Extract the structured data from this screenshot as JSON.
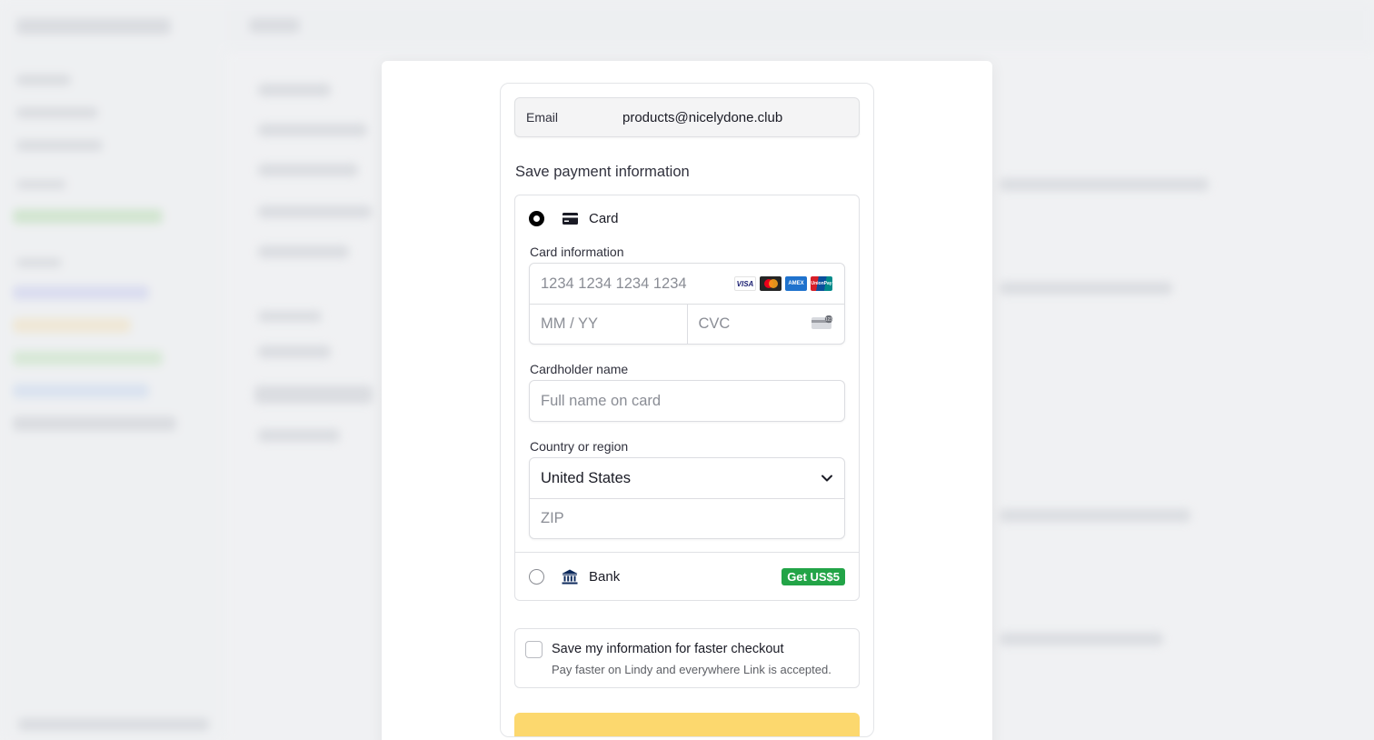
{
  "checkout": {
    "email_label": "Email",
    "email_value": "products@nicelydone.club",
    "section_title": "Save payment information",
    "card": {
      "label": "Card",
      "card_info_label": "Card information",
      "card_number_placeholder": "1234 1234 1234 1234",
      "brands": [
        "VISA",
        "",
        "AMEX",
        "UnionPay"
      ],
      "expiry_placeholder": "MM / YY",
      "cvc_placeholder": "CVC",
      "cardholder_label": "Cardholder name",
      "cardholder_placeholder": "Full name on card",
      "country_label": "Country or region",
      "country_value": "United States",
      "zip_placeholder": "ZIP"
    },
    "bank": {
      "label": "Bank",
      "badge": "Get US$5"
    },
    "save_info": {
      "title": "Save my information for faster checkout",
      "subtitle": "Pay faster on Lindy and everywhere Link is accepted."
    }
  },
  "colors": {
    "badge_green": "#22a447",
    "pay_button": "#fcd86e",
    "background": "#f0f1f3"
  }
}
